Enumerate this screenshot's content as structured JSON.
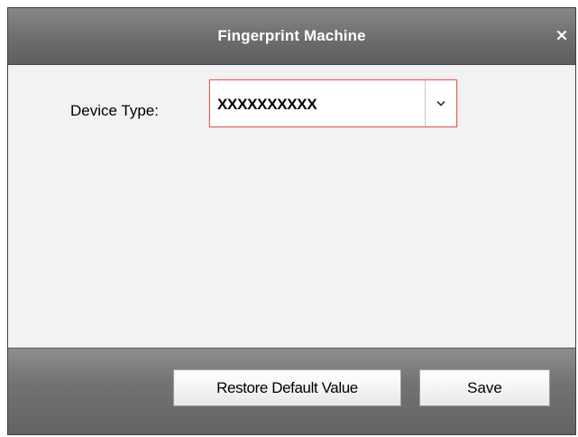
{
  "window": {
    "title": "Fingerprint Machine",
    "close_label": "×"
  },
  "form": {
    "device_type_label": "Device Type:",
    "device_type_value": "XXXXXXXXXX"
  },
  "footer": {
    "restore_label": "Restore Default Value",
    "save_label": "Save"
  },
  "icons": {
    "close": "close-icon",
    "dropdown": "chevron-down-icon"
  },
  "colors": {
    "titlebar": "#6d6d6d",
    "footer": "#737373",
    "content_bg": "#f2f2f2",
    "combo_focus_border": "#e06060"
  }
}
